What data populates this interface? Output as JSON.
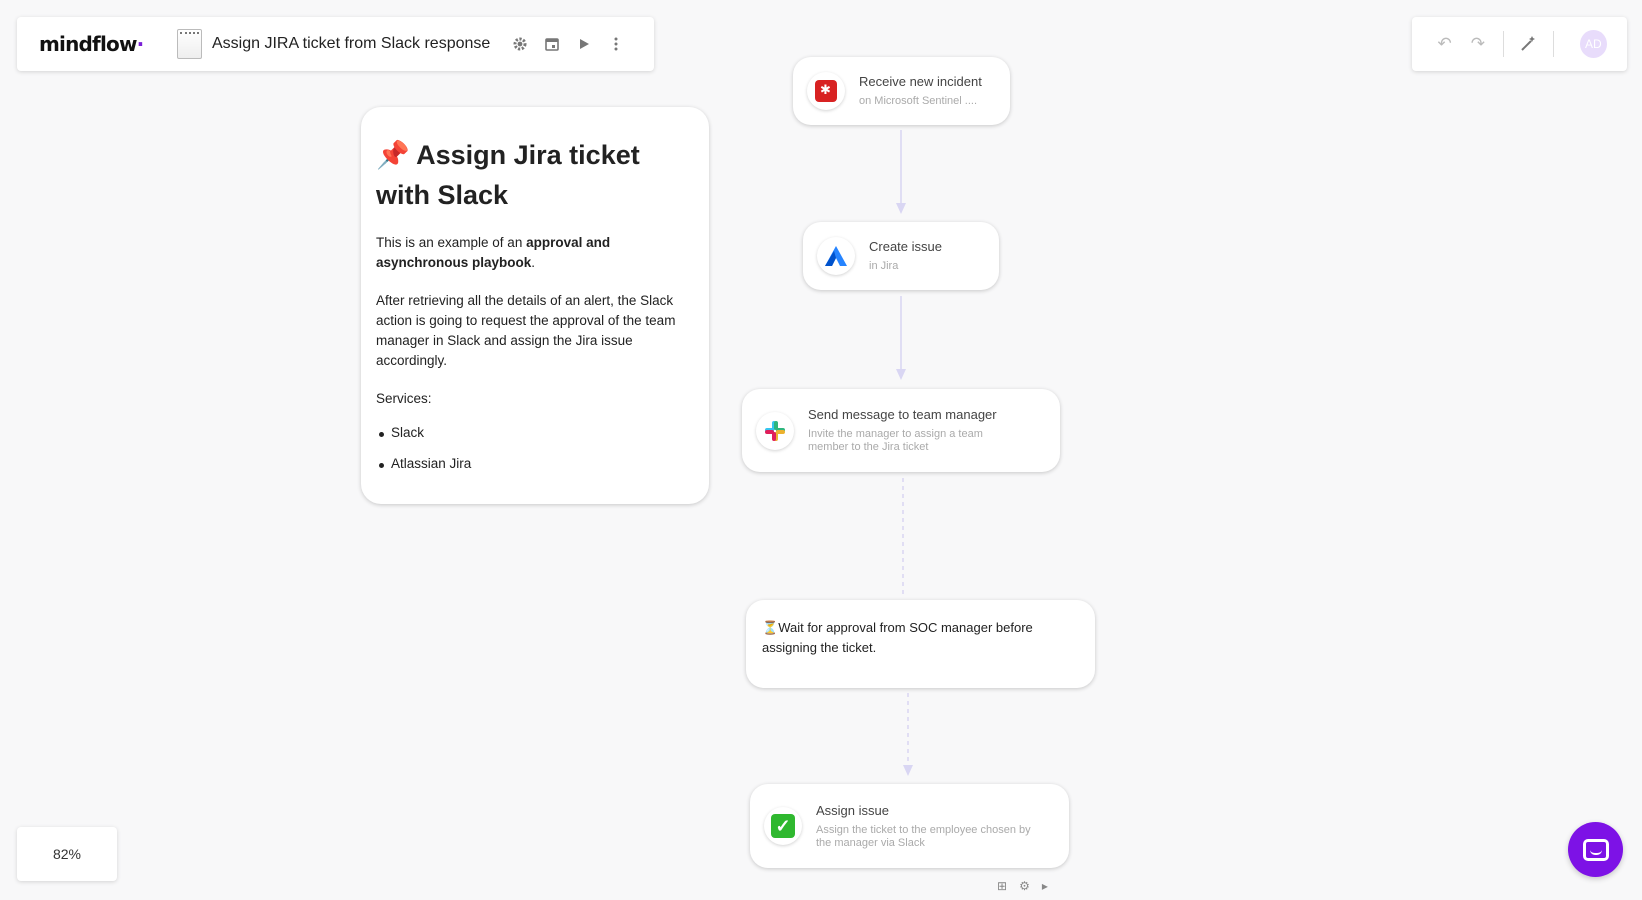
{
  "header": {
    "logo": "mindflow",
    "title": "Assign JIRA ticket from Slack response",
    "icons": [
      "gear-icon",
      "calendar-icon",
      "play-icon",
      "more-vert-icon"
    ]
  },
  "toolbar_right": {
    "icons": [
      "undo-icon",
      "redo-icon",
      "magic-wand-icon"
    ],
    "avatar_initials": "AD"
  },
  "note": {
    "emoji": "📌",
    "title": "Assign Jira ticket with Slack",
    "intro_prefix": "This is an example of an ",
    "intro_bold": "approval and asynchronous playbook",
    "intro_suffix": ".",
    "description": "After retrieving all the details of an alert, the Slack action is going to request the approval of the team manager in Slack and assign the Jira issue accordingly.",
    "services_label": "Services:",
    "services": [
      "Slack",
      "Atlassian Jira"
    ]
  },
  "nodes": {
    "incident": {
      "title": "Receive new incident",
      "subtitle": "on Microsoft Sentinel ...."
    },
    "jira": {
      "title": "Create issue",
      "subtitle": "in Jira"
    },
    "slack": {
      "title": "Send message to team manager",
      "subtitle": "Invite the manager to assign a team member to the Jira ticket"
    },
    "wait": {
      "emoji": "⏳",
      "text": "Wait for approval from SOC manager before assigning the ticket."
    },
    "assign": {
      "title": "Assign issue",
      "subtitle": "Assign the ticket to the employee chosen by the manager via Slack"
    }
  },
  "zoom": "82%",
  "colors": {
    "accent": "#7d12e6",
    "connector": "#d9d6f3"
  }
}
